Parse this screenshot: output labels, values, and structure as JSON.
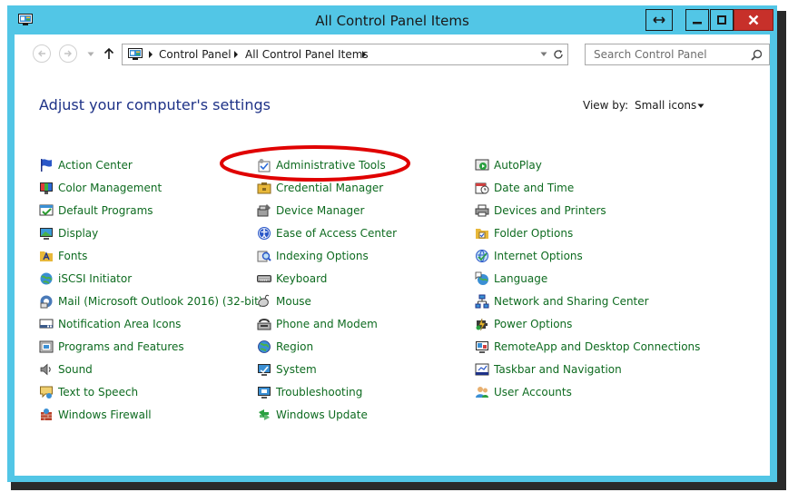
{
  "window": {
    "title": "All Control Panel Items"
  },
  "address": {
    "crumbs": [
      "Control Panel",
      "All Control Panel Items"
    ]
  },
  "search": {
    "placeholder": "Search Control Panel"
  },
  "page": {
    "heading": "Adjust your computer's settings",
    "view_by_label": "View by:",
    "view_by_value": "Small icons"
  },
  "items": {
    "col1": [
      "Action Center",
      "Color Management",
      "Default Programs",
      "Display",
      "Fonts",
      "iSCSI Initiator",
      "Mail (Microsoft Outlook 2016) (32-bit)",
      "Notification Area Icons",
      "Programs and Features",
      "Sound",
      "Text to Speech",
      "Windows Firewall"
    ],
    "col2": [
      "Administrative Tools",
      "Credential Manager",
      "Device Manager",
      "Ease of Access Center",
      "Indexing Options",
      "Keyboard",
      "Mouse",
      "Phone and Modem",
      "Region",
      "System",
      "Troubleshooting",
      "Windows Update"
    ],
    "col3": [
      "AutoPlay",
      "Date and Time",
      "Devices and Printers",
      "Folder Options",
      "Internet Options",
      "Language",
      "Network and Sharing Center",
      "Power Options",
      "RemoteApp and Desktop Connections",
      "Taskbar and Navigation",
      "User Accounts"
    ]
  },
  "colors": {
    "window_frame": "#52c6e6",
    "link_text": "#0e6b20",
    "heading_text": "#1e3287",
    "close_button": "#c7302a",
    "annotation": "#e00000"
  }
}
